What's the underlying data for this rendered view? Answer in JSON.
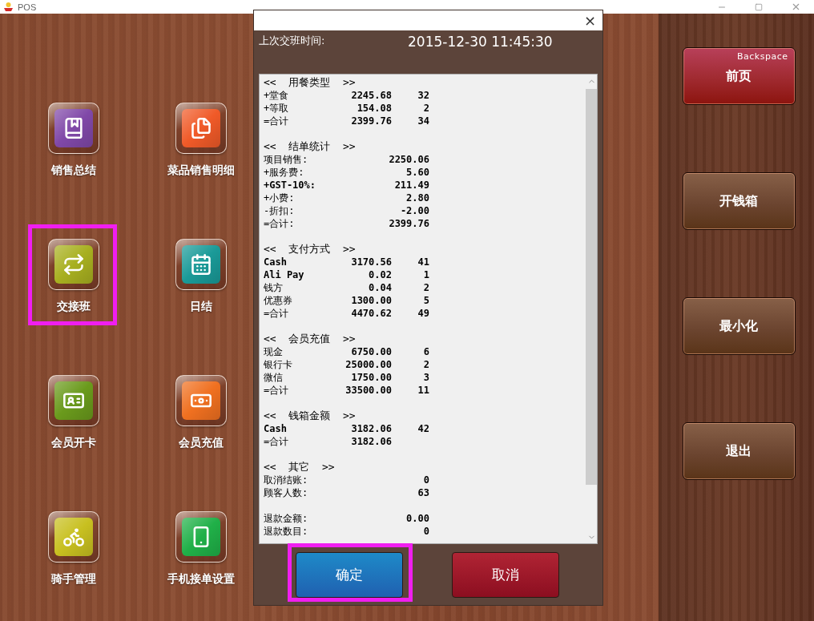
{
  "window": {
    "title": "POS"
  },
  "tiles": [
    {
      "label": "销售总结",
      "color": "#8048a8",
      "highlighted": false
    },
    {
      "label": "菜品销售明细",
      "color": "#f05a28",
      "highlighted": false
    },
    {
      "label": "交接班",
      "color": "#a8b020",
      "highlighted": true
    },
    {
      "label": "日结",
      "color": "#1a9a98",
      "highlighted": false
    },
    {
      "label": "会员开卡",
      "color": "#6a9a1c",
      "highlighted": false
    },
    {
      "label": "会员充值",
      "color": "#f07020",
      "highlighted": false
    },
    {
      "label": "骑手管理",
      "color": "#c8c020",
      "highlighted": false
    },
    {
      "label": "手机接单设置",
      "color": "#20b048",
      "highlighted": false
    }
  ],
  "side_buttons": [
    {
      "label": "前页",
      "hint": "Backspace",
      "kind": "danger"
    },
    {
      "label": "开钱箱",
      "kind": "normal"
    },
    {
      "label": "最小化",
      "kind": "normal"
    },
    {
      "label": "退出",
      "kind": "normal"
    }
  ],
  "dialog": {
    "close": "×",
    "header_label": "上次交班时间:",
    "timestamp": "2015-12-30 11:45:30",
    "report": [
      {
        "heading": "<<  用餐类型  >>",
        "rows": [
          {
            "kind": "pair",
            "label": "+堂食",
            "amount": "2245.68",
            "count": "32"
          },
          {
            "kind": "pair",
            "label": "+等取",
            "amount": "154.08",
            "count": "2"
          },
          {
            "kind": "pair",
            "label": "=合计",
            "amount": "2399.76",
            "count": "34"
          }
        ]
      },
      {
        "heading": "<<  结单统计  >>",
        "rows": [
          {
            "kind": "single",
            "label": "项目销售:",
            "amount": "2250.06"
          },
          {
            "kind": "single",
            "label": "+服务费:",
            "amount": "5.60"
          },
          {
            "kind": "single",
            "label": "+GST-10%:",
            "amount": "211.49"
          },
          {
            "kind": "single",
            "label": "+小费:",
            "amount": "2.80"
          },
          {
            "kind": "single",
            "label": "-折扣:",
            "amount": "-2.00"
          },
          {
            "kind": "single",
            "label": "=合计:",
            "amount": "2399.76"
          }
        ]
      },
      {
        "heading": "<<  支付方式  >>",
        "rows": [
          {
            "kind": "pair",
            "label": "Cash",
            "amount": "3170.56",
            "count": "41"
          },
          {
            "kind": "pair",
            "label": "Ali Pay",
            "amount": "0.02",
            "count": "1"
          },
          {
            "kind": "pair",
            "label": "钱方",
            "amount": "0.04",
            "count": "2"
          },
          {
            "kind": "pair",
            "label": "优惠券",
            "amount": "1300.00",
            "count": "5"
          },
          {
            "kind": "pair",
            "label": "=合计",
            "amount": "4470.62",
            "count": "49"
          }
        ]
      },
      {
        "heading": "<<  会员充值  >>",
        "rows": [
          {
            "kind": "pair",
            "label": "现金",
            "amount": "6750.00",
            "count": "6"
          },
          {
            "kind": "pair",
            "label": "银行卡",
            "amount": "25000.00",
            "count": "2"
          },
          {
            "kind": "pair",
            "label": "微信",
            "amount": "1750.00",
            "count": "3"
          },
          {
            "kind": "pair",
            "label": "=合计",
            "amount": "33500.00",
            "count": "11"
          }
        ]
      },
      {
        "heading": "<<  钱箱金额  >>",
        "rows": [
          {
            "kind": "pair",
            "label": "Cash",
            "amount": "3182.06",
            "count": "42"
          },
          {
            "kind": "pair",
            "label": "=合计",
            "amount": "3182.06"
          }
        ]
      },
      {
        "heading": "<<  其它  >>",
        "rows": [
          {
            "kind": "single",
            "label": "取消结账:",
            "amount": "0"
          },
          {
            "kind": "single",
            "label": "顾客人数:",
            "amount": "63"
          }
        ]
      },
      {
        "rows": [
          {
            "kind": "single",
            "label": "退款金额:",
            "amount": "0.00"
          },
          {
            "kind": "single",
            "label": "退款数目:",
            "amount": "0"
          }
        ]
      }
    ],
    "buttons": [
      {
        "label": "确定",
        "kind": "confirm",
        "highlighted": true
      },
      {
        "label": "取消",
        "kind": "cancel",
        "highlighted": false
      }
    ]
  }
}
